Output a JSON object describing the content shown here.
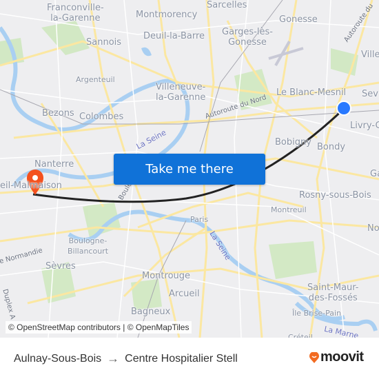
{
  "map": {
    "places": [
      {
        "name": "Franconville-la-Garenne",
        "lines": [
          "Franconville-",
          "la-Garenne"
        ]
      },
      {
        "name": "Montmorency",
        "lines": [
          "Montmorency"
        ]
      },
      {
        "name": "Sarcelles",
        "lines": [
          "Sarcelles"
        ]
      },
      {
        "name": "Gonesse",
        "lines": [
          "Gonesse"
        ]
      },
      {
        "name": "Sannois",
        "lines": [
          "Sannois"
        ]
      },
      {
        "name": "Deuil-la-Barre",
        "lines": [
          "Deuil-la-Barre"
        ]
      },
      {
        "name": "Garges-lès-Gonesse",
        "lines": [
          "Garges-lès-",
          "Gonesse"
        ]
      },
      {
        "name": "Villepinte",
        "lines": [
          "Ville"
        ]
      },
      {
        "name": "Argenteuil",
        "lines": [
          "Argenteuil"
        ]
      },
      {
        "name": "Villeneuve-la-Garenne",
        "lines": [
          "Villeneuve-",
          "la-Garenne"
        ]
      },
      {
        "name": "Le Blanc-Mesnil",
        "lines": [
          "Le Blanc-Mesnil"
        ]
      },
      {
        "name": "Sevran",
        "lines": [
          "Sev"
        ]
      },
      {
        "name": "Bezons",
        "lines": [
          "Bezons"
        ]
      },
      {
        "name": "Colombes",
        "lines": [
          "Colombes"
        ]
      },
      {
        "name": "Livry-Gargan",
        "lines": [
          "Livry-G"
        ]
      },
      {
        "name": "Bobigny",
        "lines": [
          "Bobigny"
        ]
      },
      {
        "name": "Bondy",
        "lines": [
          "Bondy"
        ]
      },
      {
        "name": "Nanterre",
        "lines": [
          "Nanterre"
        ]
      },
      {
        "name": "Rueil-Malmaison",
        "lines": [
          "eil-Malmaison"
        ]
      },
      {
        "name": "Gagny",
        "lines": [
          "Ga"
        ]
      },
      {
        "name": "Rosny-sous-Bois",
        "lines": [
          "Rosny-sous-Bois"
        ]
      },
      {
        "name": "Montreuil",
        "lines": [
          "Montreuil"
        ]
      },
      {
        "name": "Paris",
        "lines": [
          "Paris"
        ]
      },
      {
        "name": "Noisy",
        "lines": [
          "No"
        ]
      },
      {
        "name": "Boulogne-Billancourt",
        "lines": [
          "Boulogne-",
          "Billancourt"
        ]
      },
      {
        "name": "Sèvres",
        "lines": [
          "Sèvres"
        ]
      },
      {
        "name": "Montrouge",
        "lines": [
          "Montrouge"
        ]
      },
      {
        "name": "Arcueil",
        "lines": [
          "Arcueil"
        ]
      },
      {
        "name": "Saint-Maur-des-Fossés",
        "lines": [
          "Saint-Maur-",
          "des-Fossés"
        ]
      },
      {
        "name": "Bagneux",
        "lines": [
          "Bagneux"
        ]
      },
      {
        "name": "Île Brise-Pain",
        "lines": [
          "Île Brise-Pain"
        ]
      },
      {
        "name": "Créteil",
        "lines": [
          "Créteil"
        ]
      }
    ],
    "water_labels": [
      "La Seine",
      "La Seine",
      "La Marne"
    ],
    "road_labels": [
      "Autoroute du Nord",
      "Autoroute du",
      "Boule",
      "de Normandie",
      "Duplex A"
    ],
    "origin_marker": {
      "label": "Aulnay-Sous-Bois",
      "color": "#2979ff"
    },
    "destination_marker": {
      "label": "Centre Hospitalier Stell",
      "color": "#f4511e"
    },
    "route_color": "#222222"
  },
  "cta": {
    "label": "Take me there",
    "color": "#1072d8"
  },
  "attribution": "© OpenStreetMap contributors | © OpenMapTiles",
  "footer": {
    "origin": "Aulnay-Sous-Bois",
    "arrow": "→",
    "destination": "Centre Hospitalier Stell",
    "brand": "moovit",
    "brand_color": "#f26b21"
  }
}
